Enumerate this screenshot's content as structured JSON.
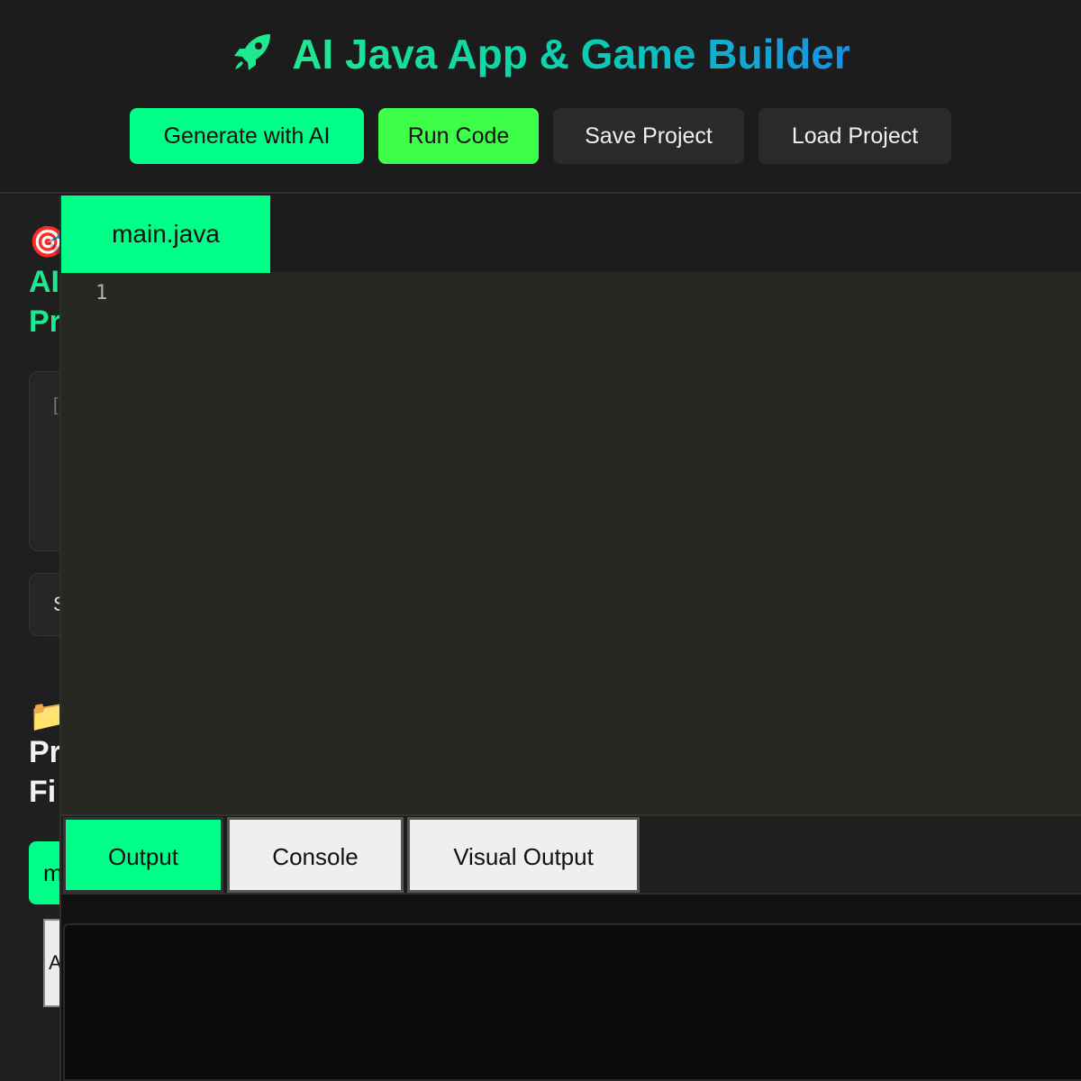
{
  "header": {
    "title": "AI Java App & Game Builder",
    "icon": "rocket-icon",
    "buttons": {
      "generate": "Generate with AI",
      "run": "Run Code",
      "save": "Save Project",
      "load": "Load Project"
    }
  },
  "sidebar": {
    "prompt_section": {
      "icon": "🎯",
      "heading_line1": "AI",
      "heading_line2": "Pr"
    },
    "prompt_placeholder": "[ e s c n i",
    "select_value": "S",
    "files_section": {
      "icon": "📁",
      "heading_line1": "Pr",
      "heading_line2": "Fi"
    },
    "file_button": "m",
    "file_box_text": "A F"
  },
  "editor": {
    "active_tab": "main.java",
    "line_numbers": [
      "1"
    ]
  },
  "output": {
    "tabs": [
      "Output",
      "Console",
      "Visual Output"
    ],
    "active_tab": "Output"
  },
  "colors": {
    "accent_green": "#00ff88",
    "run_green": "#3dff4a",
    "title_gradient_start": "#1ee890",
    "title_gradient_end": "#1890e6",
    "editor_bg": "#272822"
  }
}
